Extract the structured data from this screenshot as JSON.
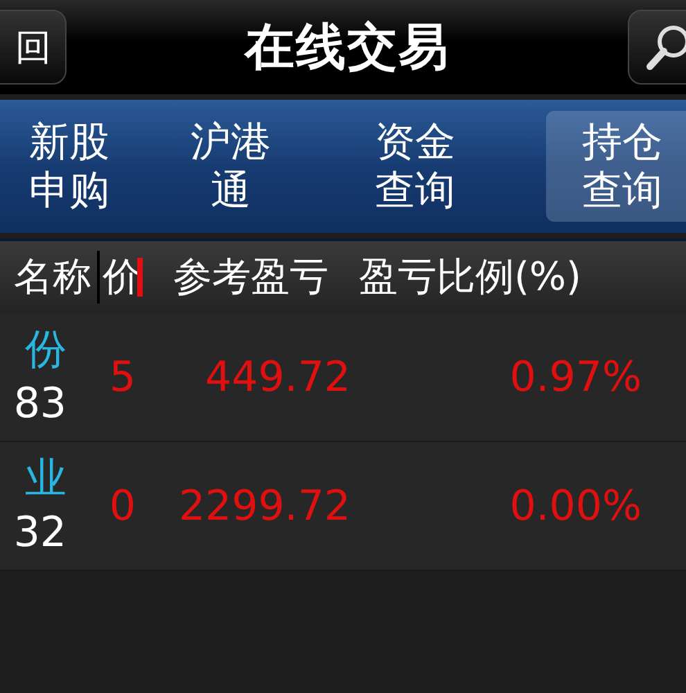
{
  "top_bar": {
    "back_button": "回",
    "title": "在线交易"
  },
  "tabs": [
    {
      "lines": [
        "新股",
        "申购"
      ],
      "selected": false
    },
    {
      "lines": [
        "沪港",
        "通"
      ],
      "selected": false
    },
    {
      "lines": [
        "资金",
        "查询"
      ],
      "selected": false
    },
    {
      "lines": [
        "持仓",
        "查询"
      ],
      "selected": true
    }
  ],
  "table": {
    "columns": [
      "名称",
      "价",
      "参考盈亏",
      "盈亏比例(%)"
    ],
    "rows": [
      {
        "name": "份",
        "code": "83",
        "price": "5",
        "profit": "449.72",
        "ratio": "0.97%"
      },
      {
        "name": "业",
        "code": "32",
        "price": "0",
        "profit": "2299.72",
        "ratio": "0.00%"
      }
    ]
  }
}
